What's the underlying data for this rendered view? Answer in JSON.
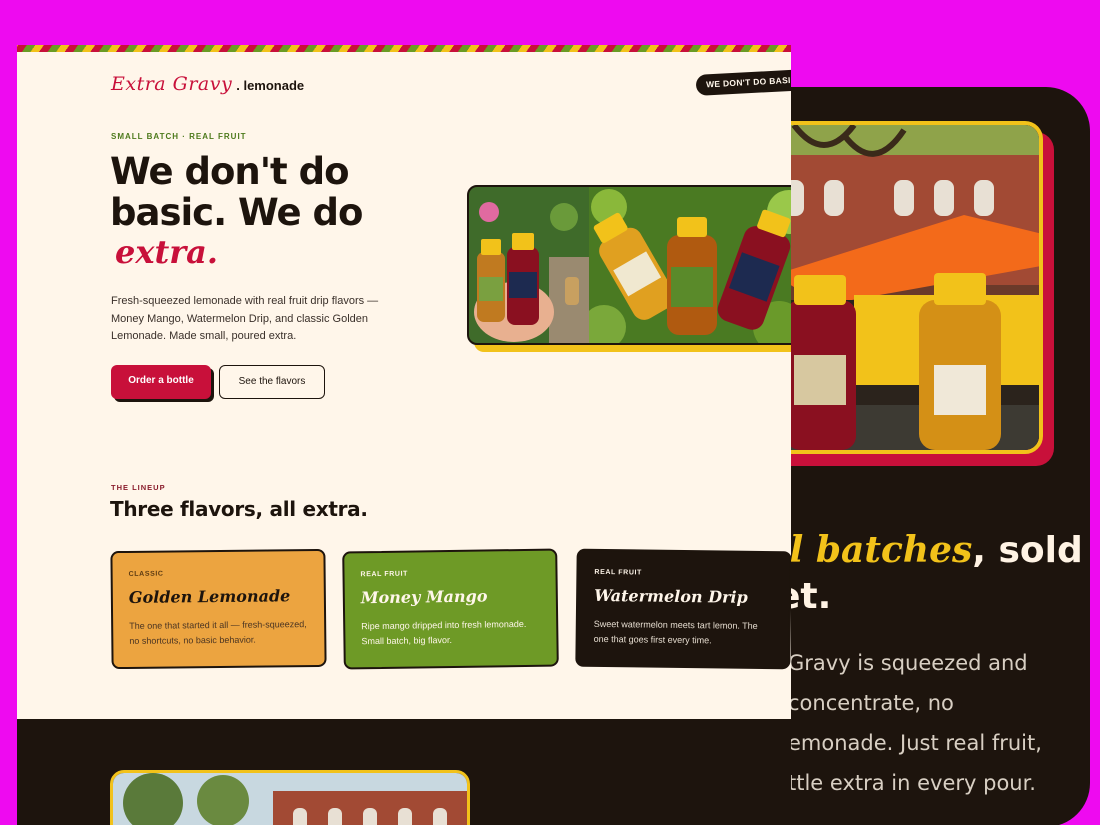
{
  "brand": {
    "script": "Extra Gravy",
    "suffix": ". lemonade"
  },
  "nav": {
    "pill": "WE DON'T DO BASIC"
  },
  "hero": {
    "eyebrow": "SMALL BATCH · REAL FRUIT",
    "title": "We don't do basic. We do",
    "accent": "extra.",
    "body": "Fresh-squeezed lemonade with real fruit drip flavors — Money Mango, Watermelon Drip, and classic Golden Lemonade. Made small, poured extra.",
    "primary_cta": "Order a bottle",
    "secondary_cta": "See the flavors"
  },
  "lineup": {
    "eyebrow": "THE LINEUP",
    "title": "Three flavors, all extra.",
    "cards": [
      {
        "label": "CLASSIC",
        "name": "Golden Lemonade",
        "desc": "The one that started it all — fresh-squeezed, no shortcuts, no basic behavior."
      },
      {
        "label": "REAL FRUIT",
        "name": "Money Mango",
        "desc": "Ripe mango dripped into fresh lemonade. Small batch, big flavor."
      },
      {
        "label": "REAL FRUIT",
        "name": "Watermelon Drip",
        "desc": "Sweet watermelon meets tart lemon. The one that goes first every time."
      }
    ]
  },
  "back_page": {
    "headline_accent": "ll batches",
    "headline_rest": ", sold",
    "headline_line2": "et.",
    "body_lines": [
      " Gravy is squeezed and",
      "concentrate, no",
      "emonade. Just real fruit,",
      "ttle extra in every pour."
    ]
  },
  "colors": {
    "background": "#ee0af0",
    "cream": "#fff6ea",
    "dark": "#1d140d",
    "red": "#c8103a",
    "yellow": "#f2c21a",
    "green": "#6e9a26",
    "orange": "#eca440"
  }
}
